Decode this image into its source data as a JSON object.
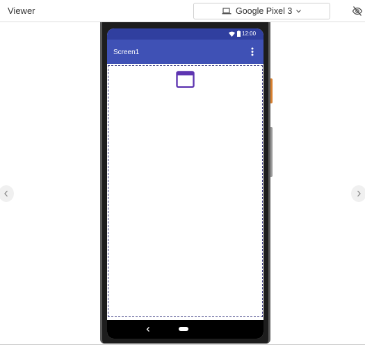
{
  "viewer": {
    "title": "Viewer",
    "device_select": {
      "value": "Google Pixel 3",
      "icon": "device-icon"
    },
    "visibility_toggle_icon": "eye-slash-icon"
  },
  "phone": {
    "status_bar": {
      "time": "12:00",
      "icons": [
        "wifi-icon",
        "battery-icon"
      ]
    },
    "app_bar": {
      "title": "Screen1",
      "menu_icon": "overflow-menu-icon"
    },
    "canvas": {
      "component_icons": [
        "window-component-icon"
      ]
    },
    "nav_bar": {
      "buttons": [
        "back-icon",
        "home-icon"
      ]
    }
  },
  "colors": {
    "status_bar": "#303f9f",
    "app_bar": "#3f51b5",
    "component_icon": "#5e35b1",
    "power_button": "#d8802f"
  }
}
